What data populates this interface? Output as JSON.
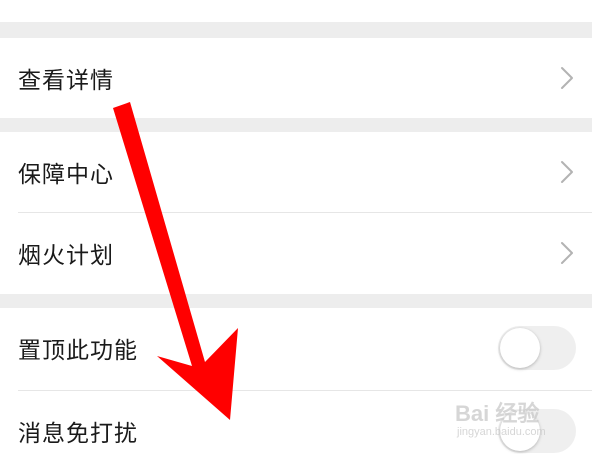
{
  "settings": {
    "section1": {
      "view_details_label": "查看详情"
    },
    "section2": {
      "guarantee_center_label": "保障中心",
      "fireworks_plan_label": "烟火计划"
    },
    "section3": {
      "pin_feature_label": "置顶此功能",
      "pin_feature_enabled": false,
      "do_not_disturb_label": "消息免打扰",
      "do_not_disturb_enabled": false
    }
  },
  "annotation": {
    "arrow_color": "#ff0000"
  },
  "watermark": {
    "text": "Bai 经验",
    "sub": "jingyan.baidu.com"
  },
  "colors": {
    "background": "#ededed",
    "card": "#ffffff",
    "text": "#1a1a1a",
    "chevron": "#b3b3b3"
  }
}
